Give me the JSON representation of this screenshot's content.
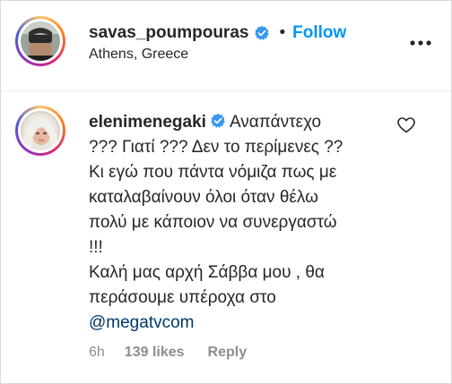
{
  "post_header": {
    "username": "savas_poumpouras",
    "follow_label": "Follow",
    "separator": "•",
    "location": "Athens, Greece",
    "verified_icon": "verified-badge-icon",
    "more_icon": "more-options-icon"
  },
  "comment": {
    "username": "elenimenegaki",
    "verified_icon": "verified-badge-icon",
    "lines": [
      "Αναπάντεχο",
      "??? Γιατί ??? Δεν το περίμενες ??",
      "Κι εγώ που πάντα νόμιζα πως με",
      "καταλαβαίνουν όλοι όταν θέλω",
      "πολύ με κάποιον να συνεργαστώ",
      "!!!",
      "Καλή μας αρχή Σάββα μου , θα",
      "περάσουμε υπέροχα στο"
    ],
    "mention": "@megatvcom",
    "time": "6h",
    "likes": "139 likes",
    "reply_label": "Reply",
    "like_icon": "heart-icon"
  },
  "colors": {
    "accent": "#0095f6",
    "text": "#262626",
    "muted": "#8e8e8e",
    "mention": "#00376b",
    "verified": "#3897f0"
  }
}
